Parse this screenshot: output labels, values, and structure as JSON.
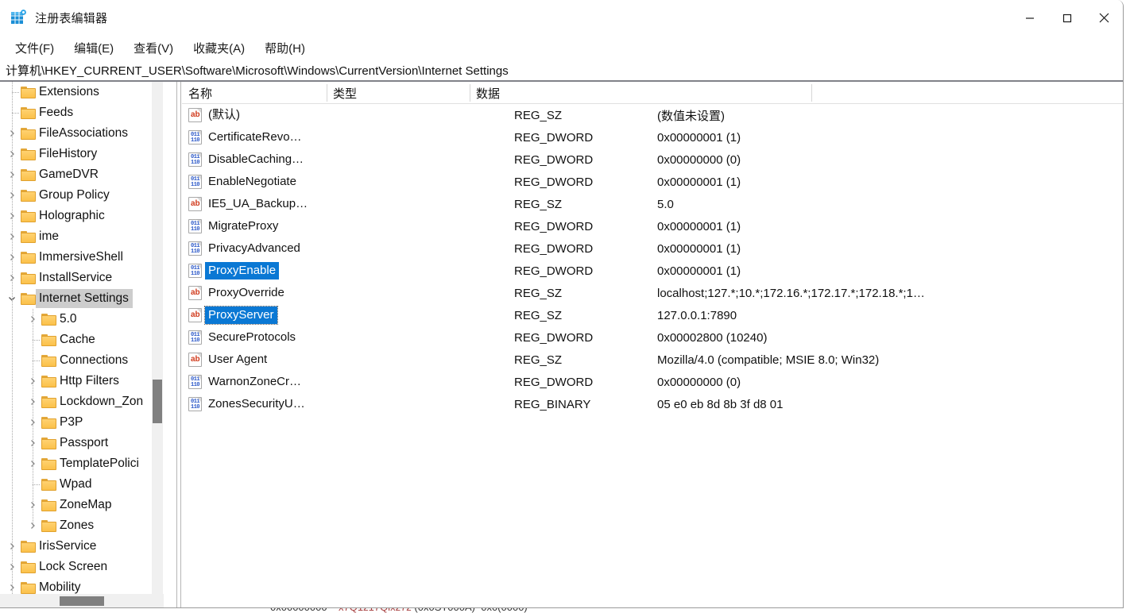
{
  "window": {
    "title": "注册表编辑器",
    "app_icon": "registry-editor-icon",
    "controls": {
      "minimize": "minimize-icon",
      "maximize": "maximize-icon",
      "close": "close-icon"
    }
  },
  "menubar": {
    "items": [
      {
        "label": "文件(F)"
      },
      {
        "label": "编辑(E)"
      },
      {
        "label": "查看(V)"
      },
      {
        "label": "收藏夹(A)"
      },
      {
        "label": "帮助(H)"
      }
    ]
  },
  "address": {
    "path": "计算机\\HKEY_CURRENT_USER\\Software\\Microsoft\\Windows\\CurrentVersion\\Internet Settings"
  },
  "tree": {
    "items": [
      {
        "label": "Extensions",
        "depth": 1,
        "twisty": "none",
        "selected": false
      },
      {
        "label": "Feeds",
        "depth": 1,
        "twisty": "none",
        "selected": false
      },
      {
        "label": "FileAssociations",
        "depth": 1,
        "twisty": "collapsed",
        "selected": false
      },
      {
        "label": "FileHistory",
        "depth": 1,
        "twisty": "collapsed",
        "selected": false
      },
      {
        "label": "GameDVR",
        "depth": 1,
        "twisty": "collapsed",
        "selected": false
      },
      {
        "label": "Group Policy",
        "depth": 1,
        "twisty": "collapsed",
        "selected": false
      },
      {
        "label": "Holographic",
        "depth": 1,
        "twisty": "collapsed",
        "selected": false
      },
      {
        "label": "ime",
        "depth": 1,
        "twisty": "collapsed",
        "selected": false
      },
      {
        "label": "ImmersiveShell",
        "depth": 1,
        "twisty": "collapsed",
        "selected": false
      },
      {
        "label": "InstallService",
        "depth": 1,
        "twisty": "collapsed",
        "selected": false
      },
      {
        "label": "Internet Settings",
        "depth": 1,
        "twisty": "expanded",
        "selected": true
      },
      {
        "label": "5.0",
        "depth": 2,
        "twisty": "collapsed",
        "selected": false
      },
      {
        "label": "Cache",
        "depth": 2,
        "twisty": "none",
        "selected": false
      },
      {
        "label": "Connections",
        "depth": 2,
        "twisty": "none",
        "selected": false
      },
      {
        "label": "Http Filters",
        "depth": 2,
        "twisty": "collapsed",
        "selected": false
      },
      {
        "label": "Lockdown_Zon",
        "depth": 2,
        "twisty": "collapsed",
        "selected": false
      },
      {
        "label": "P3P",
        "depth": 2,
        "twisty": "collapsed",
        "selected": false
      },
      {
        "label": "Passport",
        "depth": 2,
        "twisty": "collapsed",
        "selected": false
      },
      {
        "label": "TemplatePolici",
        "depth": 2,
        "twisty": "collapsed",
        "selected": false
      },
      {
        "label": "Wpad",
        "depth": 2,
        "twisty": "none",
        "selected": false
      },
      {
        "label": "ZoneMap",
        "depth": 2,
        "twisty": "collapsed",
        "selected": false
      },
      {
        "label": "Zones",
        "depth": 2,
        "twisty": "collapsed",
        "selected": false
      },
      {
        "label": "IrisService",
        "depth": 1,
        "twisty": "collapsed",
        "selected": false
      },
      {
        "label": "Lock Screen",
        "depth": 1,
        "twisty": "collapsed",
        "selected": false
      },
      {
        "label": "Mobility",
        "depth": 1,
        "twisty": "collapsed",
        "selected": false
      }
    ]
  },
  "list": {
    "columns": [
      {
        "label": "名称"
      },
      {
        "label": "类型"
      },
      {
        "label": "数据"
      }
    ],
    "rows": [
      {
        "name": "(默认)",
        "type": "REG_SZ",
        "data": "(数值未设置)",
        "icon": "string-value-icon",
        "selected": false,
        "focused": false
      },
      {
        "name": "CertificateRevo…",
        "type": "REG_DWORD",
        "data": "0x00000001 (1)",
        "icon": "dword-value-icon",
        "selected": false,
        "focused": false
      },
      {
        "name": "DisableCaching…",
        "type": "REG_DWORD",
        "data": "0x00000000 (0)",
        "icon": "dword-value-icon",
        "selected": false,
        "focused": false
      },
      {
        "name": "EnableNegotiate",
        "type": "REG_DWORD",
        "data": "0x00000001 (1)",
        "icon": "dword-value-icon",
        "selected": false,
        "focused": false
      },
      {
        "name": "IE5_UA_Backup…",
        "type": "REG_SZ",
        "data": "5.0",
        "icon": "string-value-icon",
        "selected": false,
        "focused": false
      },
      {
        "name": "MigrateProxy",
        "type": "REG_DWORD",
        "data": "0x00000001 (1)",
        "icon": "dword-value-icon",
        "selected": false,
        "focused": false
      },
      {
        "name": "PrivacyAdvanced",
        "type": "REG_DWORD",
        "data": "0x00000001 (1)",
        "icon": "dword-value-icon",
        "selected": false,
        "focused": false
      },
      {
        "name": "ProxyEnable",
        "type": "REG_DWORD",
        "data": "0x00000001 (1)",
        "icon": "dword-value-icon",
        "selected": true,
        "focused": false
      },
      {
        "name": "ProxyOverride",
        "type": "REG_SZ",
        "data": "localhost;127.*;10.*;172.16.*;172.17.*;172.18.*;1…",
        "icon": "string-value-icon",
        "selected": false,
        "focused": false
      },
      {
        "name": "ProxyServer",
        "type": "REG_SZ",
        "data": "127.0.0.1:7890",
        "icon": "string-value-icon",
        "selected": true,
        "focused": true
      },
      {
        "name": "SecureProtocols",
        "type": "REG_DWORD",
        "data": "0x00002800 (10240)",
        "icon": "dword-value-icon",
        "selected": false,
        "focused": false
      },
      {
        "name": "User Agent",
        "type": "REG_SZ",
        "data": "Mozilla/4.0 (compatible; MSIE 8.0; Win32)",
        "icon": "string-value-icon",
        "selected": false,
        "focused": false
      },
      {
        "name": "WarnonZoneCr…",
        "type": "REG_DWORD",
        "data": "0x00000000 (0)",
        "icon": "dword-value-icon",
        "selected": false,
        "focused": false
      },
      {
        "name": "ZonesSecurityU…",
        "type": "REG_BINARY",
        "data": "05 e0 eb 8d 8b 3f d8 01",
        "icon": "dword-value-icon",
        "selected": false,
        "focused": false
      }
    ]
  },
  "colors": {
    "selection": "#0a78d4",
    "tree_selection": "#cdcdcd",
    "folder": "#fbc14a",
    "scrollbar_thumb": "#808080"
  }
}
